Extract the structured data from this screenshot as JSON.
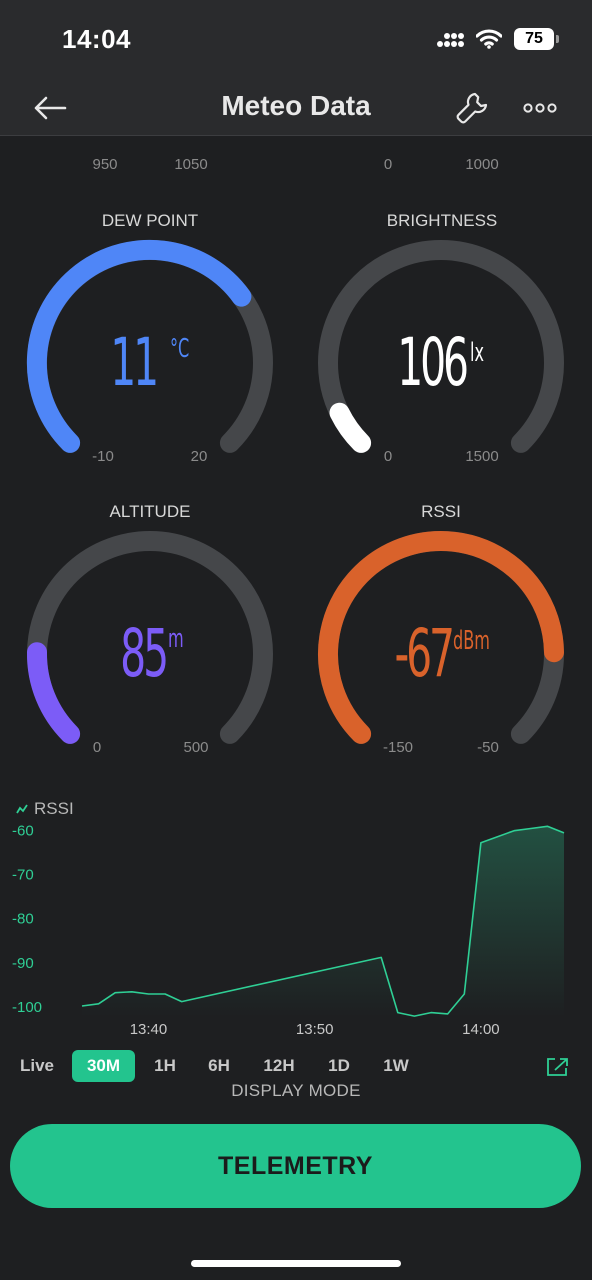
{
  "status_bar": {
    "time": "14:04",
    "battery": "75"
  },
  "header": {
    "title": "Meteo Data",
    "back_icon": "arrow-left-icon",
    "settings_icon": "wrench-icon",
    "more_icon": "more-icon"
  },
  "top_partial_gauges": [
    {
      "color": "#5cc155",
      "min": "950",
      "max": "1050"
    },
    {
      "color": "#f0c23a",
      "min": "0",
      "max": "1000"
    }
  ],
  "gauges": [
    {
      "label": "DEW POINT",
      "value": "11",
      "unit": "°C",
      "min": "-10",
      "max": "20",
      "fraction": 0.7,
      "color": "#4f86f7",
      "text_color": "#4f86f7"
    },
    {
      "label": "BRIGHTNESS",
      "value": "106",
      "unit": "lx",
      "min": "0",
      "max": "1500",
      "fraction": 0.07,
      "color": "#ffffff",
      "text_color": "#ffffff"
    },
    {
      "label": "ALTITUDE",
      "value": "85",
      "unit": "m",
      "min": "0",
      "max": "500",
      "fraction": 0.17,
      "color": "#7c5cf7",
      "text_color": "#7c5cf7"
    },
    {
      "label": "RSSI",
      "value": "-67",
      "unit": "dBm",
      "min": "-150",
      "max": "-50",
      "fraction": 0.83,
      "color": "#d9622b",
      "text_color": "#d9622b"
    }
  ],
  "chart_data": {
    "type": "area",
    "series": [
      {
        "name": "RSSI",
        "color": "#2fcf95",
        "points": [
          [
            "13:36",
            -100
          ],
          [
            "13:37",
            -99.5
          ],
          [
            "13:38",
            -97
          ],
          [
            "13:39",
            -96.8
          ],
          [
            "13:40",
            -97.3
          ],
          [
            "13:41",
            -97.3
          ],
          [
            "13:42",
            -99
          ],
          [
            "13:54",
            -89
          ],
          [
            "13:55",
            -101.5
          ],
          [
            "13:56",
            -102.3
          ],
          [
            "13:57",
            -101.5
          ],
          [
            "13:58",
            -101.8
          ],
          [
            "13:59",
            -97.3
          ],
          [
            "14:00",
            -63
          ],
          [
            "14:02",
            -60.3
          ],
          [
            "14:03",
            -59.8
          ],
          [
            "14:04",
            -59.3
          ],
          [
            "14:05",
            -60.8
          ]
        ]
      }
    ],
    "y_ticks": [
      "-60",
      "-70",
      "-80",
      "-90",
      "-100"
    ],
    "x_ticks": [
      "13:40",
      "13:50",
      "14:00"
    ],
    "ylim": [
      -102.5,
      -59
    ],
    "xlim": [
      "13:36",
      "14:05"
    ]
  },
  "display_modes": {
    "options": [
      "Live",
      "30M",
      "1H",
      "6H",
      "12H",
      "1D",
      "1W"
    ],
    "selected": "30M",
    "caption": "DISPLAY MODE"
  },
  "telemetry_button": "TELEMETRY"
}
